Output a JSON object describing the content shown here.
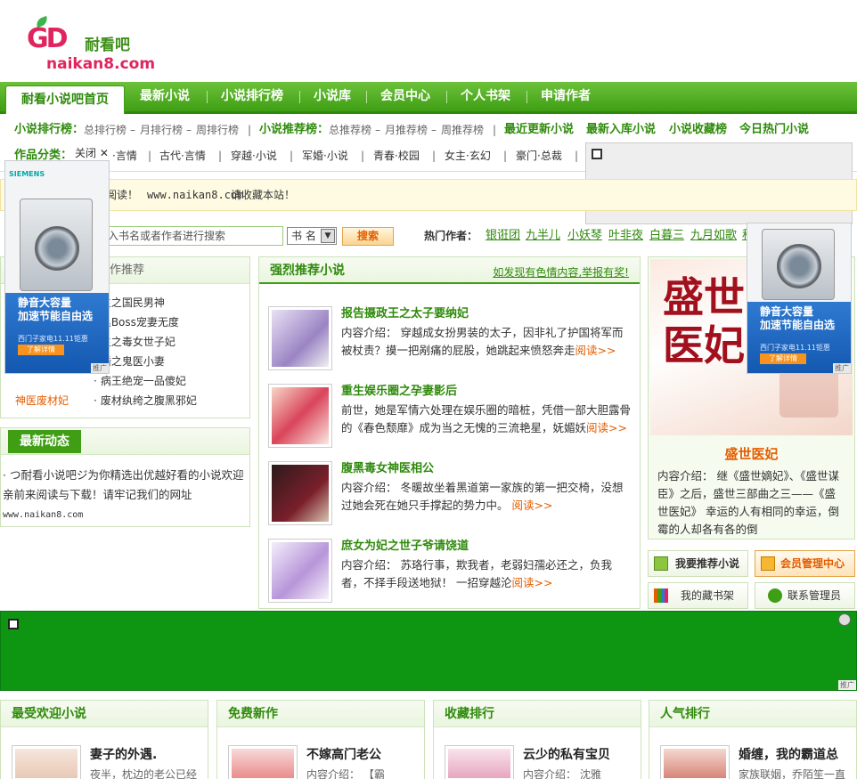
{
  "logo": {
    "cn": "耐看吧",
    "en": "naikan8.com",
    "mark": "GD"
  },
  "nav": {
    "home": "耐看小说吧首页",
    "items": [
      "最新小说",
      "小说排行榜",
      "小说库",
      "会员中心",
      "个人书架",
      "申请作者"
    ]
  },
  "subnav": {
    "rank_label": "小说排行榜：",
    "rank_items": [
      "总排行榜",
      "月排行榜",
      "周排行榜"
    ],
    "recommend_label": "小说推荐榜：",
    "recommend_items": [
      "总推荐榜",
      "月推荐榜",
      "周推荐榜"
    ],
    "bold_links": [
      "最近更新小说",
      "最新入库小说",
      "小说收藏榜",
      "今日热门小说"
    ],
    "category_label": "作品分类：",
    "categories": [
      "·言情",
      "古代·言情",
      "穿越·小说",
      "军婚·小说",
      "青春·校园",
      "女主·玄幻",
      "豪门·总裁"
    ]
  },
  "notice": {
    "text_a": "阅读！",
    "url": "www.naikan8.com",
    "text_b": "请收藏本站！"
  },
  "search": {
    "placeholder": "入书名或者作者进行搜索",
    "select_value": "书 名",
    "button": "搜索",
    "hot_label": "热门作者：",
    "authors": [
      "银诳团",
      "九半儿",
      "小妖琴",
      "叶非夜",
      "白暮三",
      "九月如歌",
      "秋"
    ]
  },
  "left_panel": {
    "title_partial": "作推荐",
    "items": [
      "生之国民男神",
      "黑Boss宠妻无度",
      "生之毒女世子妃",
      "婚之鬼医小妻",
      "病王绝宠一品傻妃",
      "废材纨绔之腹黑邪妃"
    ],
    "left_link": "神医废材妃"
  },
  "news_panel": {
    "title": "最新动态",
    "body_a": "· つ耐看小说吧ジ为你精选出优越好看的小说欢迎亲前来阅读与下载！请牢记我们的网址",
    "url": "www.naikan8.com"
  },
  "center_panel": {
    "title": "强烈推荐小说",
    "report": "如发现有色情内容,举报有奖!",
    "books": [
      {
        "title": "报告摄政王之太子要纳妃",
        "desc": "内容介绍： 穿越成女扮男装的太子，因非礼了护国将军而被杖责？摸一把剐痛的屁股，她跳起来愤怒奔走",
        "read": "阅读>>"
      },
      {
        "title": "重生娱乐圈之孕妻影后",
        "desc": "前世，她是军情六处理在娱乐圈的暗桩，凭借一部大胆露骨的《春色颓靡》成为当之无愧的三流艳星，妩媚妖",
        "read": "阅读>>"
      },
      {
        "title": "腹黑毒女神医相公",
        "desc": "内容介绍： 冬暖故坐着黑道第一家族的第一把交椅，没想过她会死在她只手撑起的势力中。",
        "read": "阅读>>"
      },
      {
        "title": "庶女为妃之世子爷请饶道",
        "desc": "内容介绍： 苏珞行事，欺我者，老弱妇孺必还之，负我者，不择手段送地狱！ 一招穿越沦",
        "read": "阅读>>"
      }
    ]
  },
  "right_panel": {
    "feature_title": "盛世医妃",
    "feature_desc": "内容介绍： 继《盛世嫡妃》、《盛世谋臣》之后，盛世三部曲之三——《盛世医妃》 幸运的人有相同的幸运，倒霉的人却各有各的倒",
    "cover_text": "盛世医妃",
    "buttons": [
      "我要推荐小说",
      "会员管理中心",
      "我的藏书架",
      "联系管理员"
    ]
  },
  "ads": {
    "close_label": "关闭",
    "brand": "SIEMENS",
    "line1": "静音大容量",
    "line2": "加速节能自由选",
    "small": "西门子家电11.11钜惠",
    "btn": "了解详情",
    "tag": "推广"
  },
  "bottom_panels": [
    {
      "title": "最受欢迎小说",
      "book": "妻子的外遇.",
      "desc": "夜半，枕边的老公已经"
    },
    {
      "title": "免费新作",
      "book": "不嫁高门老公",
      "desc": "内容介绍： 【霸"
    },
    {
      "title": "收藏排行",
      "book": "云少的私有宝贝",
      "desc": "内容介绍： 沈雅"
    },
    {
      "title": "人气排行",
      "book": "婚缠，我的霸道总",
      "desc": "家族联姻，乔陌笙一直"
    }
  ],
  "colors": {
    "brand_green": "#3f9e14",
    "accent_orange": "#e45d00",
    "banner_green": "#0e9613"
  }
}
